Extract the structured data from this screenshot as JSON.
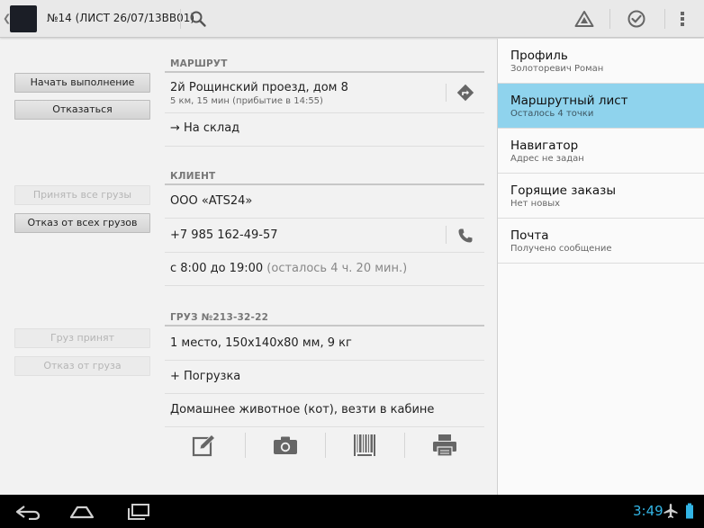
{
  "actionbar": {
    "title": "№14 (ЛИСТ 26/07/13ВВ01)",
    "icons": [
      "search-icon",
      "warning-icon",
      "check-circle-icon",
      "overflow-menu-icon"
    ]
  },
  "left_buttons": {
    "start": "Начать выполнение",
    "refuse": "Отказаться",
    "accept_all": "Принять все грузы",
    "refuse_all": "Отказ от всех грузов",
    "accept_cargo": "Груз принят",
    "refuse_cargo": "Отказ от груза"
  },
  "route": {
    "header": "МАРШРУТ",
    "address": "2й Рощинский проезд, дом 8",
    "eta": "5 км, 15 мин (прибытие в 14:55)",
    "destination": "→ На склад"
  },
  "client": {
    "header": "КЛИЕНТ",
    "name": "ООО «ATS24»",
    "phone": "+7 985 162-49-57",
    "hours": "с 8:00 до 19:00",
    "remaining": "(осталось 4 ч. 20 мин.)"
  },
  "cargo": {
    "header": "ГРУЗ №213-32-22",
    "details": "1 место, 150х140х80 мм, 9 кг",
    "loading": "+ Погрузка",
    "note": "Домашнее животное (кот), везти в кабине"
  },
  "nav": {
    "items": [
      {
        "title": "Профиль",
        "subtitle": "Золоторевич Роман"
      },
      {
        "title": "Маршрутный лист",
        "subtitle": "Осталось 4 точки"
      },
      {
        "title": "Навигатор",
        "subtitle": "Адрес не задан"
      },
      {
        "title": "Горящие заказы",
        "subtitle": "Нет новых"
      },
      {
        "title": "Почта",
        "subtitle": "Получено сообщение"
      }
    ],
    "active_index": 1
  },
  "system": {
    "clock": "3:49"
  },
  "colors": {
    "accent": "#8fd3ed",
    "clock": "#33b5e5"
  }
}
